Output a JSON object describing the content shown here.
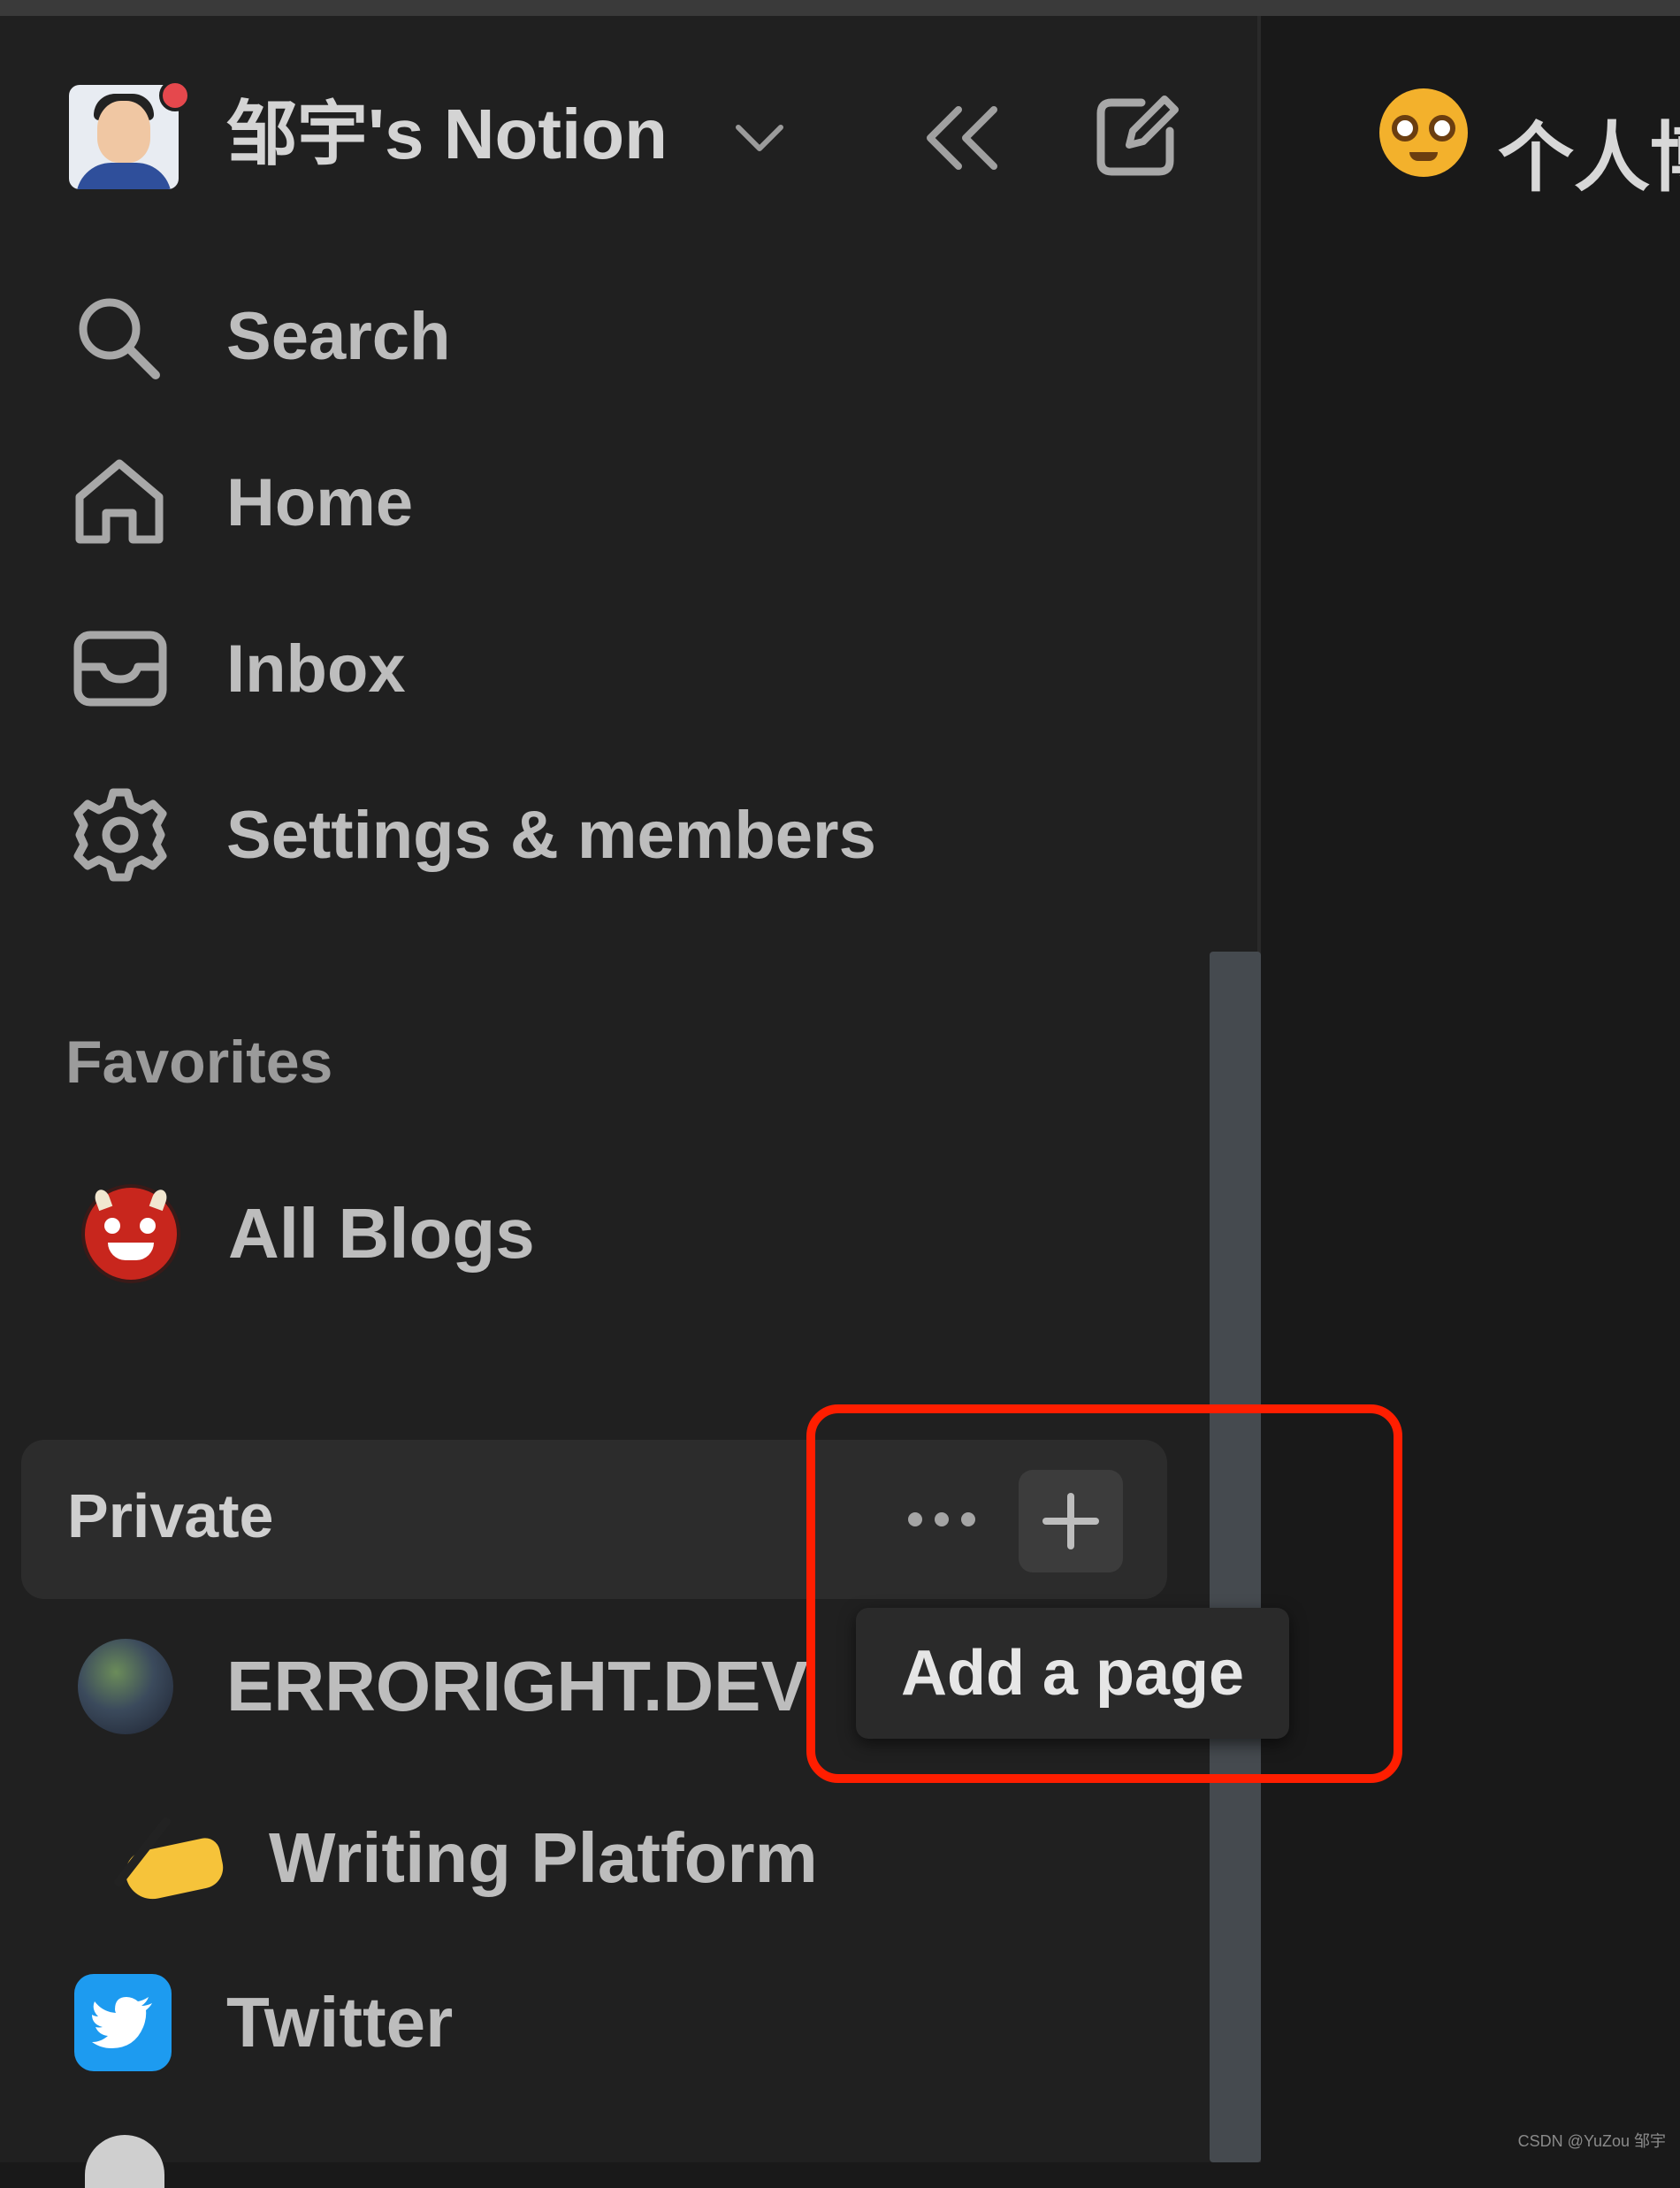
{
  "workspace": {
    "name": "邹宇's Notion",
    "notification_color": "#e5484d"
  },
  "header_actions": {
    "collapse_icon": "double-chevron-left-icon",
    "new_page_icon": "compose-icon"
  },
  "nav": {
    "items": [
      {
        "label": "Search",
        "icon": "search-icon"
      },
      {
        "label": "Home",
        "icon": "home-icon"
      },
      {
        "label": "Inbox",
        "icon": "inbox-icon"
      },
      {
        "label": "Settings & members",
        "icon": "gear-icon"
      }
    ]
  },
  "favorites": {
    "heading": "Favorites",
    "items": [
      {
        "label": "All Blogs",
        "icon": "ogre-emoji-icon"
      }
    ]
  },
  "private": {
    "heading": "Private",
    "more_icon": "ellipsis-icon",
    "add_icon": "plus-icon",
    "tooltip": "Add a page",
    "items": [
      {
        "label": "ERRORIGHT.DEV",
        "icon": "page-avatar-icon"
      },
      {
        "label": "Writing Platform",
        "icon": "writing-hand-emoji-icon"
      },
      {
        "label": "Twitter",
        "icon": "twitter-icon"
      }
    ]
  },
  "main": {
    "title": "个人博",
    "emoji": "nerd-face-emoji-icon"
  },
  "watermark": "CSDN @YuZou 邹宇",
  "colors": {
    "sidebar_bg": "#202020",
    "main_bg": "#191919",
    "highlight": "#ff1e00",
    "twitter_blue": "#1d9bf0"
  }
}
